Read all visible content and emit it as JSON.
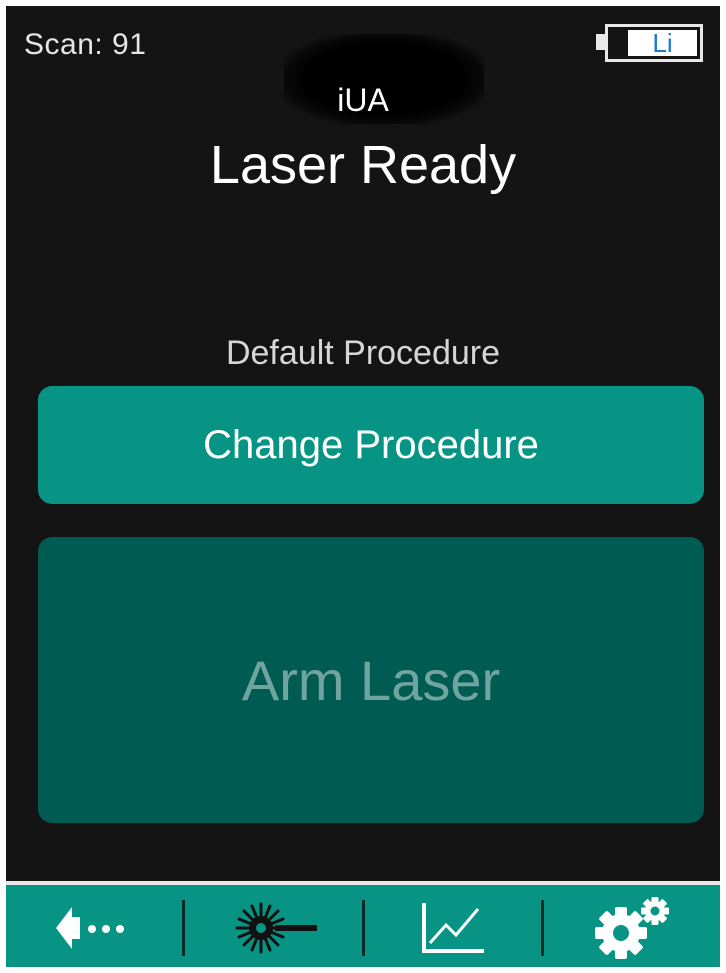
{
  "header": {
    "scan_label": "Scan: 91",
    "device_name": "iUA",
    "status": "Laser Ready"
  },
  "battery": {
    "chemistry": "Li"
  },
  "procedure": {
    "current": "Default Procedure",
    "change_label": "Change Procedure"
  },
  "arm": {
    "label": "Arm Laser"
  },
  "navbar": {
    "items": [
      {
        "icon": "back-icon"
      },
      {
        "icon": "laser-icon"
      },
      {
        "icon": "chart-icon"
      },
      {
        "icon": "settings-gear-icon"
      }
    ]
  },
  "colors": {
    "background": "#141414",
    "accent": "#079484",
    "arm_button": "#005c52",
    "arm_text": "#6fa59e"
  }
}
